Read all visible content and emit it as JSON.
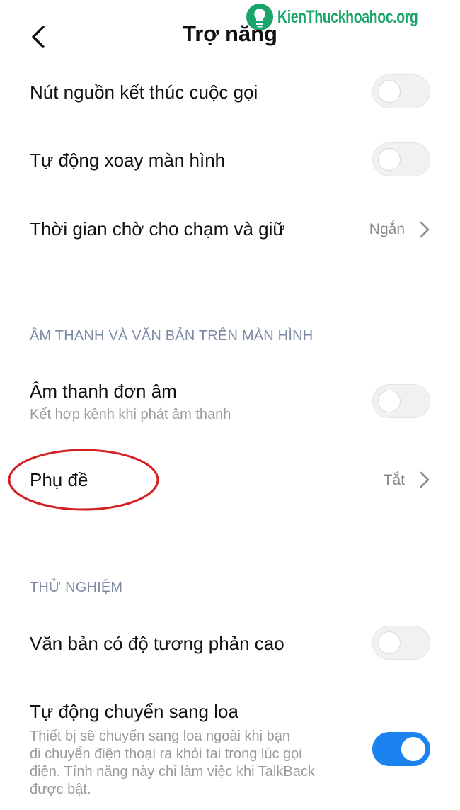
{
  "header": {
    "title": "Trợ năng",
    "back_icon": "chevron-left-icon"
  },
  "watermark": {
    "text": "KienThuckhoahoc.org",
    "icon": "lightbulb-logo-icon"
  },
  "rows": [
    {
      "title": "Nút nguồn kết thúc cuộc gọi",
      "type": "toggle",
      "on": false
    },
    {
      "title": "Tự động xoay màn hình",
      "type": "toggle",
      "on": false
    },
    {
      "title": "Thời gian chờ cho chạm và giữ",
      "type": "nav",
      "value": "Ngắn"
    }
  ],
  "sections": [
    {
      "header": "ÂM THANH VÀ VĂN BẢN TRÊN MÀN HÌNH",
      "rows": [
        {
          "title": "Âm thanh đơn âm",
          "subtitle": "Kết hợp kênh khi phát âm thanh",
          "type": "toggle",
          "on": false
        },
        {
          "title": "Phụ đề",
          "type": "nav",
          "value": "Tắt",
          "highlighted": true
        }
      ]
    },
    {
      "header": "THỬ NGHIỆM",
      "rows": [
        {
          "title": "Văn bản có độ tương phản cao",
          "type": "toggle",
          "on": false
        },
        {
          "title": "Tự động chuyển sang loa",
          "subtitle_lines": [
            "Thiết bị sẽ chuyển sang loa ngoài khi bạn",
            "di chuyển điện thoại ra khỏi tai trong lúc gọi",
            "điện. Tính năng này chỉ làm việc khi TalkBack",
            "được bật."
          ],
          "type": "toggle",
          "on": true
        }
      ]
    }
  ],
  "colors": {
    "accent": "#1c82f0",
    "section_header": "#7d8aa3",
    "annotation": "#d42020",
    "watermark": "#1aa56a"
  }
}
